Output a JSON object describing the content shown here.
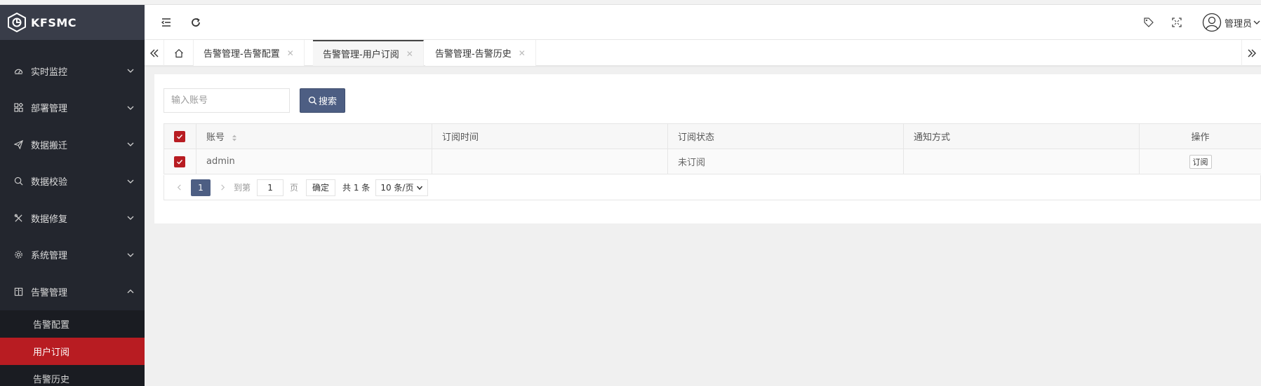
{
  "app": {
    "name": "KFSMC"
  },
  "sidebar": {
    "items": [
      {
        "label": "实时监控",
        "icon": "dashboard-icon"
      },
      {
        "label": "部署管理",
        "icon": "apps-icon"
      },
      {
        "label": "数据搬迁",
        "icon": "send-icon"
      },
      {
        "label": "数据校验",
        "icon": "search-check-icon"
      },
      {
        "label": "数据修复",
        "icon": "tools-icon"
      },
      {
        "label": "系统管理",
        "icon": "gear-icon"
      },
      {
        "label": "告警管理",
        "icon": "book-icon"
      }
    ],
    "submenu": [
      {
        "label": "告警配置"
      },
      {
        "label": "用户订阅"
      },
      {
        "label": "告警历史"
      }
    ]
  },
  "header": {
    "user_name": "管理员"
  },
  "tabs": [
    {
      "label": "告警管理-告警配置"
    },
    {
      "label": "告警管理-用户订阅"
    },
    {
      "label": "告警管理-告警历史"
    }
  ],
  "search": {
    "placeholder": "输入账号",
    "button_label": "搜索"
  },
  "table": {
    "columns": [
      "账号",
      "订阅时间",
      "订阅状态",
      "通知方式",
      "操作"
    ],
    "rows": [
      {
        "account": "admin",
        "subscribe_time": "",
        "status": "未订阅",
        "notify": "",
        "action": "订阅"
      }
    ]
  },
  "pager": {
    "current_page": "1",
    "goto_prefix": "到第",
    "goto_value": "1",
    "goto_suffix": "页",
    "confirm_label": "确定",
    "total_label": "共 1 条",
    "per_page_label": "10 条/页"
  },
  "colors": {
    "sidebar_bg": "#23262e",
    "logo_bg": "#393d49",
    "accent_red": "#b81c22",
    "primary_button": "#4d5e83"
  }
}
